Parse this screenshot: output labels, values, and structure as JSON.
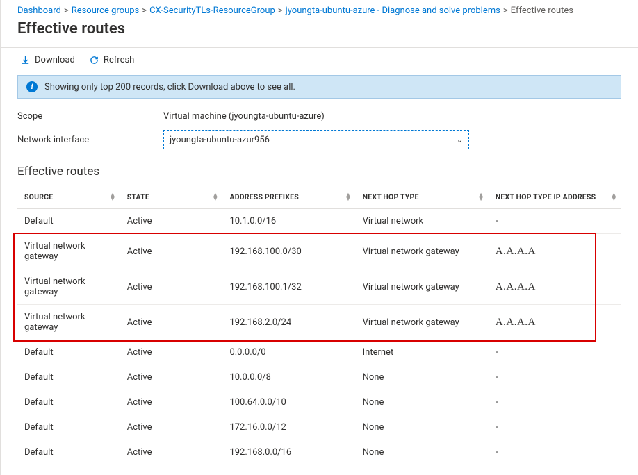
{
  "breadcrumb": {
    "items": [
      {
        "label": "Dashboard"
      },
      {
        "label": "Resource groups"
      },
      {
        "label": "CX-SecurityTLs-ResourceGroup"
      },
      {
        "label": "jyoungta-ubuntu-azure - Diagnose and solve problems"
      }
    ],
    "current": "Effective routes"
  },
  "title": "Effective routes",
  "toolbar": {
    "download": "Download",
    "refresh": "Refresh"
  },
  "info_bar": "Showing only top 200 records, click Download above to see all.",
  "fields": {
    "scope_label": "Scope",
    "scope_value": "Virtual machine (jyoungta-ubuntu-azure)",
    "nic_label": "Network interface",
    "nic_value": "jyoungta-ubuntu-azur956"
  },
  "subheading": "Effective routes",
  "columns": {
    "source": "SOURCE",
    "state": "STATE",
    "prefix": "ADDRESS PREFIXES",
    "nexthop": "NEXT HOP TYPE",
    "ip": "NEXT HOP TYPE IP ADDRESS"
  },
  "rows": [
    {
      "source": "Default",
      "state": "Active",
      "prefix": "10.1.0.0/16",
      "nexthop": "Virtual network",
      "ip": "-",
      "highlight": false
    },
    {
      "source": "Virtual network gateway",
      "state": "Active",
      "prefix": "192.168.100.0/30",
      "nexthop": "Virtual network gateway",
      "ip": "A.A.A.A",
      "highlight": true
    },
    {
      "source": "Virtual network gateway",
      "state": "Active",
      "prefix": "192.168.100.1/32",
      "nexthop": "Virtual network gateway",
      "ip": "A.A.A.A",
      "highlight": true
    },
    {
      "source": "Virtual network gateway",
      "state": "Active",
      "prefix": "192.168.2.0/24",
      "nexthop": "Virtual network gateway",
      "ip": "A.A.A.A",
      "highlight": true
    },
    {
      "source": "Default",
      "state": "Active",
      "prefix": "0.0.0.0/0",
      "nexthop": "Internet",
      "ip": "-",
      "highlight": false
    },
    {
      "source": "Default",
      "state": "Active",
      "prefix": "10.0.0.0/8",
      "nexthop": "None",
      "ip": "-",
      "highlight": false
    },
    {
      "source": "Default",
      "state": "Active",
      "prefix": "100.64.0.0/10",
      "nexthop": "None",
      "ip": "-",
      "highlight": false
    },
    {
      "source": "Default",
      "state": "Active",
      "prefix": "172.16.0.0/12",
      "nexthop": "None",
      "ip": "-",
      "highlight": false
    },
    {
      "source": "Default",
      "state": "Active",
      "prefix": "192.168.0.0/16",
      "nexthop": "None",
      "ip": "-",
      "highlight": false
    }
  ]
}
